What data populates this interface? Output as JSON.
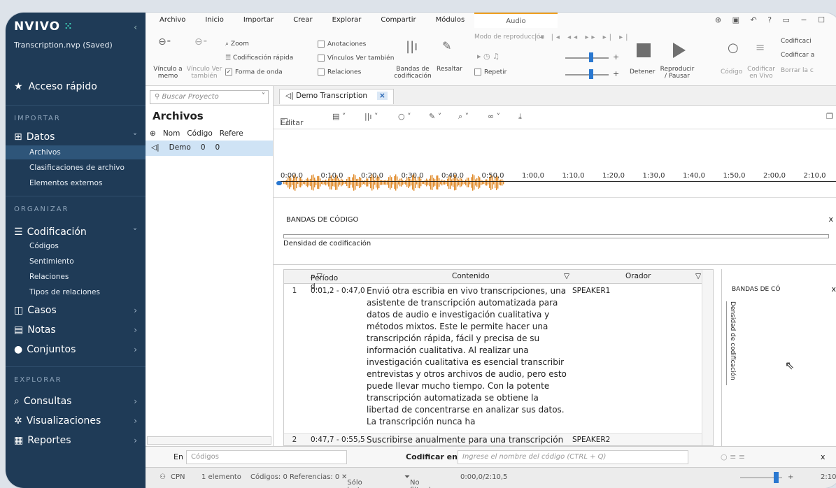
{
  "app": {
    "logo": "NVIVO",
    "project": "Transcription.nvp (Saved)"
  },
  "sidebar": {
    "quick": "Acceso rápido",
    "sections": {
      "importar": "IMPORTAR",
      "organizar": "ORGANIZAR",
      "explorar": "EXPLORAR"
    },
    "datos": "Datos",
    "archivos": "Archivos",
    "clasif": "Clasificaciones de archivo",
    "externos": "Elementos externos",
    "codificacion": "Codificación",
    "codigos": "Códigos",
    "sentimiento": "Sentimiento",
    "relaciones": "Relaciones",
    "tipos": "Tipos de relaciones",
    "casos": "Casos",
    "notas": "Notas",
    "conjuntos": "Conjuntos",
    "consultas": "Consultas",
    "visualizaciones": "Visualizaciones",
    "reportes": "Reportes"
  },
  "ribbon": {
    "tabs": [
      "Archivo",
      "Inicio",
      "Importar",
      "Crear",
      "Explorar",
      "Compartir",
      "Módulos",
      "Audio"
    ],
    "zoom": "Zoom",
    "codif_rapida": "Codificación rápida",
    "forma_onda": "Forma de onda",
    "anotaciones": "Anotaciones",
    "vinculos": "Vínculos Ver también",
    "relaciones": "Relaciones",
    "vinculo_memo": "Vínculo a memo",
    "vinculo_ver": "Vínculo Ver también",
    "bandas": "Bandas de codificación",
    "resaltar": "Resaltar",
    "modo": "Modo de reproducción",
    "repetir": "Repetir",
    "detener": "Detener",
    "reproducir": "Reproducir / Pausar",
    "codigo": "Código",
    "codificar_vivo": "Codificar en Vivo",
    "codif1": "Codificaci",
    "codif2": "Codificar a",
    "borrar": "Borrar la c"
  },
  "left": {
    "search": "Buscar Proyecto",
    "title": "Archivos",
    "col_nom": "Nom",
    "col_codigo": "Código",
    "col_refere": "Refere",
    "row_name": "Demo",
    "row_codigo": "0",
    "row_refs": "0"
  },
  "doc": {
    "tab": "Demo Transcription",
    "editar": "Editar",
    "ticks": [
      "0:00,0",
      "0:10,0",
      "0:20,0",
      "0:30,0",
      "0:40,0",
      "0:50,0",
      "1:00,0",
      "1:10,0",
      "1:20,0",
      "1:30,0",
      "1:40,0",
      "1:50,0",
      "2:00,0",
      "2:10,0"
    ],
    "bandas": "BANDAS DE CÓDIGO",
    "densidad": "Densidad de codificación",
    "headers": {
      "periodo": "Período d...",
      "contenido": "Contenido",
      "orador": "Orador"
    },
    "rows": [
      {
        "n": "1",
        "per": "0:01,2 - 0:47,0",
        "cont": "Envió otra escribia en vivo transcripciones, una asistente de transcripción automatizada para datos de audio e investigación cualitativa y métodos mixtos. Este le permite hacer una transcripción rápida, fácil y precisa de su información cualitativa. Al realizar una investigación cualitativa es esencial transcribir entrevistas y otros archivos de audio, pero esto puede llevar mucho tiempo. Con la potente transcripción automatizada se obtiene la libertad de concentrarse en analizar sus datos. La transcripción nunca ha",
        "spk": "SPEAKER1"
      },
      {
        "n": "2",
        "per": "0:47,7 - 0:55,5",
        "cont": "Suscribirse anualmente para una transcripción ilimitada o haga un pago por uso si solamente",
        "spk": "SPEAKER2"
      }
    ],
    "side_title": "BANDAS DE CÓ",
    "side_dens": "Densidad de codificación"
  },
  "codebar": {
    "en": "En",
    "codigos": "Códigos",
    "codificar_en": "Codificar en",
    "placeholder": "Ingrese el nombre del código (CTRL + Q)"
  },
  "status": {
    "user": "CPN",
    "elem": "1 elemento",
    "codigos": "Códigos: 0 Referencias: 0",
    "lectura": "Sólo lectura",
    "filtro": "No filtrado",
    "tiempo": "0:00,0/2:10,5",
    "end": "2:10"
  }
}
